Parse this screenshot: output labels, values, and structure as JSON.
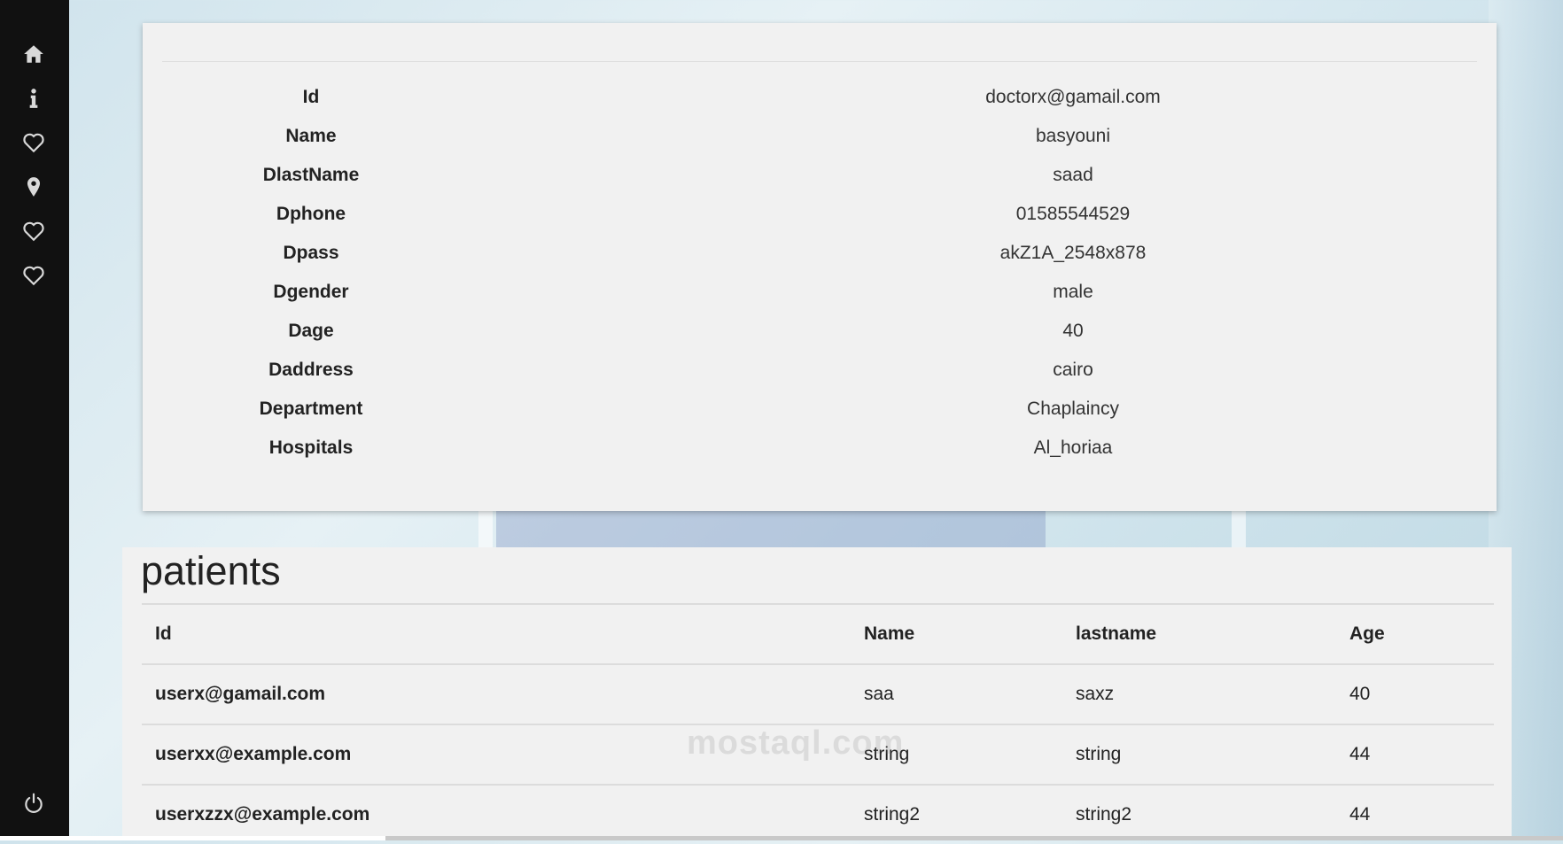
{
  "doctor": {
    "fields": [
      {
        "label": "Id",
        "value": "doctorx@gamail.com"
      },
      {
        "label": "Name",
        "value": "basyouni"
      },
      {
        "label": "DlastName",
        "value": "saad"
      },
      {
        "label": "Dphone",
        "value": "01585544529"
      },
      {
        "label": "Dpass",
        "value": "akZ1A_2548x878"
      },
      {
        "label": "Dgender",
        "value": "male"
      },
      {
        "label": "Dage",
        "value": "40"
      },
      {
        "label": "Daddress",
        "value": "cairo"
      },
      {
        "label": "Department",
        "value": "Chaplaincy"
      },
      {
        "label": "Hospitals",
        "value": "Al_horiaa"
      }
    ]
  },
  "patients": {
    "title": "patients",
    "columns": [
      "Id",
      "Name",
      "lastname",
      "Age"
    ],
    "rows": [
      [
        "userx@gamail.com",
        "saa",
        "saxz",
        "40"
      ],
      [
        "userxx@example.com",
        "string",
        "string",
        "44"
      ],
      [
        "userxzzx@example.com",
        "string2",
        "string2",
        "44"
      ]
    ]
  },
  "sidebar": {
    "icons": [
      "home-icon",
      "info-icon",
      "heart-icon",
      "location-pin-icon",
      "heart-icon",
      "heart-icon",
      "power-icon"
    ]
  },
  "watermark": "mostaql.com"
}
